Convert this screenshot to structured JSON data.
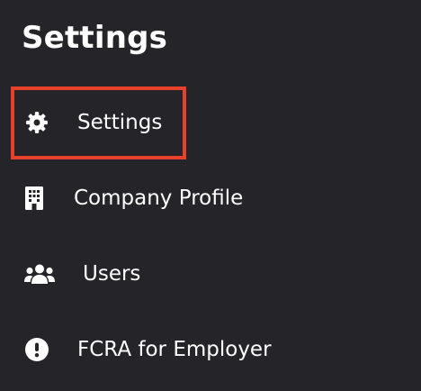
{
  "page": {
    "title": "Settings"
  },
  "nav": {
    "items": [
      {
        "label": "Settings",
        "icon": "gear-icon",
        "highlighted": true
      },
      {
        "label": "Company Profile",
        "icon": "building-icon"
      },
      {
        "label": "Users",
        "icon": "users-icon"
      },
      {
        "label": "FCRA for Employer",
        "icon": "exclamation-circle-icon"
      }
    ]
  },
  "colors": {
    "background": "#252529",
    "text": "#ffffff",
    "highlight_border": "#e8402a"
  }
}
